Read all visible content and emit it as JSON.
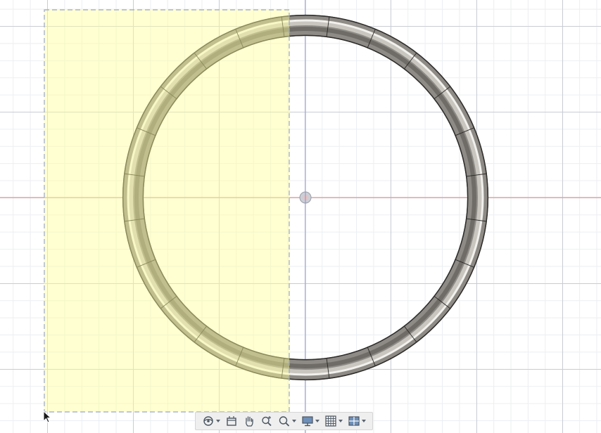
{
  "app": {
    "view": "top"
  },
  "colors": {
    "selection_fill": "#ffffc8",
    "selection_border": "#9aa7c9",
    "ring_selected": "#8f8a4a",
    "ring_unselected": "#7d7b78",
    "x_axis": "#e06b6b",
    "y_axis": "#8a8fd6",
    "toolbar_bg": "#efefef"
  },
  "scene": {
    "model": "torus-ring",
    "ring_segments": 24,
    "selection": "window-selection"
  },
  "toolbar": {
    "items": [
      {
        "name": "orbit-icon",
        "has_dropdown": true
      },
      {
        "name": "look-at-icon",
        "has_dropdown": false
      },
      {
        "name": "pan-hand-icon",
        "has_dropdown": false
      },
      {
        "name": "zoom-icon",
        "has_dropdown": false
      },
      {
        "name": "fit-zoom-icon",
        "has_dropdown": true
      },
      {
        "name": "display-settings-icon",
        "has_dropdown": true
      },
      {
        "name": "grid-snap-icon",
        "has_dropdown": true
      },
      {
        "name": "viewports-icon",
        "has_dropdown": true
      }
    ]
  }
}
